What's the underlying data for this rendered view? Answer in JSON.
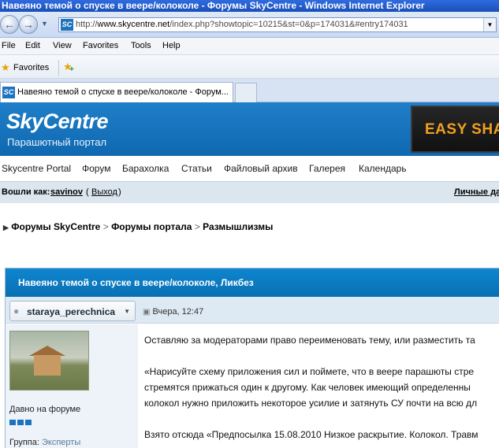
{
  "window": {
    "title": "Навеяно темой о спуске в веере/колоколе - Форумы SkyCentre - Windows Internet Explorer"
  },
  "address": {
    "favicon": "SC",
    "url_prefix": "http://",
    "url_host": "www.skycentre.net",
    "url_rest": "/index.php?showtopic=10215&st=0&p=174031&#entry174031"
  },
  "menu": {
    "items": [
      "File",
      "Edit",
      "View",
      "Favorites",
      "Tools",
      "Help"
    ]
  },
  "favorites": {
    "label": "Favorites"
  },
  "tabs": [
    {
      "label": "Навеяно темой о спуске в веере/колоколе - Форум..."
    }
  ],
  "site": {
    "logo": "SkyCentre",
    "tagline": "Парашютный портал",
    "banner": "EASY SHA"
  },
  "nav": {
    "items": [
      "Skycentre Portal",
      "Форум",
      "Барахолка",
      "Статьи",
      "Файловый архив",
      "Галерея",
      "Календарь"
    ]
  },
  "userbar": {
    "logged_as": "Вошли как:",
    "username": "savinov",
    "open_paren": "(",
    "logout": "Выход",
    "close_paren": ")",
    "personal": "Личные да"
  },
  "breadcrumb": {
    "items": [
      "Форумы SkyCentre",
      "Форумы портала",
      "Размышлизмы"
    ],
    "separator": ">"
  },
  "topic": {
    "title": "Навеяно темой о спуске в веере/колоколе, Ликбез",
    "author": "staraya_perechnica",
    "date": "Вчера, 12:47",
    "author_since": "Давно на форуме",
    "group_label": "Группа:",
    "group_value": "Эксперты",
    "lines": [
      "Оставляю за модераторами право переименовать тему, или разместить та",
      "«Нарисуйте схему приложения сил и поймете, что в веере парашюты стре",
      "стремятся прижаться один к другому. Как человек имеющий определенны",
      "колокол нужно приложить некоторое усилие и затянуть СУ почти на всю дл",
      "Взято отсюда «Предпосылка 15.08.2010 Низкое раскрытие. Колокол. Травм"
    ]
  },
  "icons": {
    "back": "back-arrow-icon",
    "forward": "forward-arrow-icon",
    "favorites": "star-icon",
    "add_favorite": "add-favorite-icon",
    "author": "person-icon",
    "post": "post-icon"
  },
  "colors": {
    "header_blue": "#1f7fc8",
    "topic_blue": "#0e86d0",
    "banner_orange": "#f0a020"
  }
}
